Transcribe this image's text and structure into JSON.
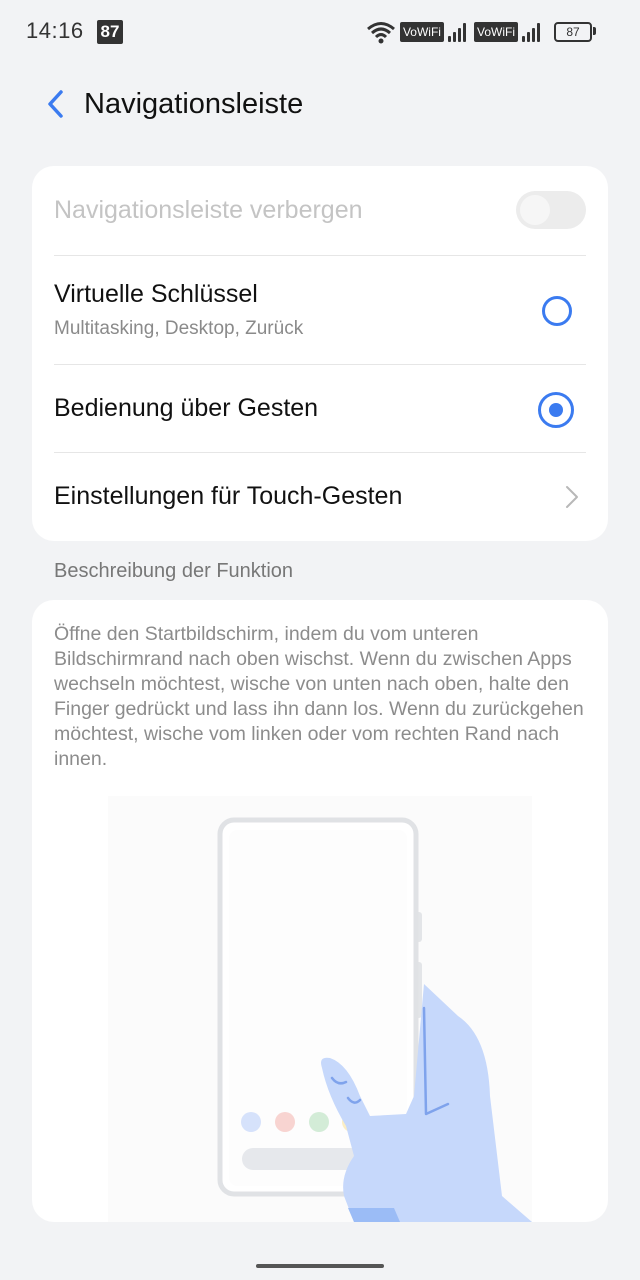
{
  "status_bar": {
    "time": "14:16",
    "notification_badge": "87",
    "network_label_1": "VoWiFi",
    "network_label_2": "VoWiFi",
    "battery": "87"
  },
  "header": {
    "title": "Navigationsleiste",
    "back_icon": "chevron-left-icon"
  },
  "settings": {
    "hide_bar_label": "Navigationsleiste verbergen",
    "hide_bar_enabled": false,
    "virtual_keys_label": "Virtuelle Schlüssel",
    "virtual_keys_sub": "Multitasking, Desktop, Zurück",
    "virtual_keys_selected": false,
    "gestures_label": "Bedienung über Gesten",
    "gestures_selected": true,
    "touch_settings_label": "Einstellungen für Touch-Gesten"
  },
  "description": {
    "section_label": "Beschreibung der Funktion",
    "text": "Öffne den Startbildschirm, indem du vom unteren Bildschirmrand nach oben wischst. Wenn du zwischen Apps wechseln möchtest, wische von unten nach oben, halte den Finger gedrückt und lass ihn dann los. Wenn du zurückgehen möchtest, wische vom linken oder vom rechten Rand nach innen."
  },
  "colors": {
    "accent": "#3b7bf0",
    "background": "#f2f3f5",
    "card": "#ffffff"
  }
}
